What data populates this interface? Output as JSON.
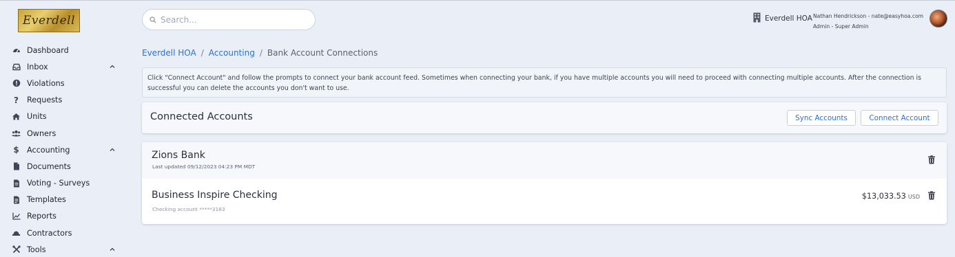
{
  "logo": {
    "text": "Everdell"
  },
  "sidebar": {
    "items": [
      {
        "label": "Dashboard",
        "icon": "dashboard-icon",
        "chevron": false
      },
      {
        "label": "Inbox",
        "icon": "inbox-icon",
        "chevron": true
      },
      {
        "label": "Violations",
        "icon": "alert-circle-icon",
        "chevron": false
      },
      {
        "label": "Requests",
        "icon": "question-icon",
        "chevron": false
      },
      {
        "label": "Units",
        "icon": "home-icon",
        "chevron": false
      },
      {
        "label": "Owners",
        "icon": "users-icon",
        "chevron": false
      },
      {
        "label": "Accounting",
        "icon": "dollar-icon",
        "chevron": true
      },
      {
        "label": "Documents",
        "icon": "document-icon",
        "chevron": false
      },
      {
        "label": "Voting - Surveys",
        "icon": "ballot-icon",
        "chevron": false
      },
      {
        "label": "Templates",
        "icon": "template-icon",
        "chevron": false
      },
      {
        "label": "Reports",
        "icon": "chart-icon",
        "chevron": false
      },
      {
        "label": "Contractors",
        "icon": "hard-hat-icon",
        "chevron": false
      },
      {
        "label": "Tools",
        "icon": "tools-icon",
        "chevron": true
      }
    ]
  },
  "search": {
    "placeholder": "Search..."
  },
  "header": {
    "hoa_name": "Everdell HOA",
    "user_line": "Nathan Hendrickson - nate@easyhoa.com",
    "role_line": "Admin - Super Admin"
  },
  "breadcrumb": {
    "items": [
      "Everdell HOA",
      "Accounting",
      "Bank Account Connections"
    ],
    "separator": "/"
  },
  "info_text": "Click \"Connect Account\" and follow the prompts to connect your bank account feed. Sometimes when connecting your bank, if you have multiple accounts you will need to proceed with connecting multiple accounts. After the connection is successful you can delete the accounts you don't want to use.",
  "connected": {
    "title": "Connected Accounts",
    "sync_label": "Sync Accounts",
    "connect_label": "Connect Account"
  },
  "bank": {
    "name": "Zions Bank",
    "updated": "Last updated 09/12/2023 04:23 PM MDT",
    "account": {
      "name": "Business Inspire Checking",
      "sub": "Checking account *****3183",
      "balance": "$13,033.53",
      "currency": "USD"
    }
  },
  "colors": {
    "accent": "#2f6fd0",
    "background": "#e9eef7"
  }
}
